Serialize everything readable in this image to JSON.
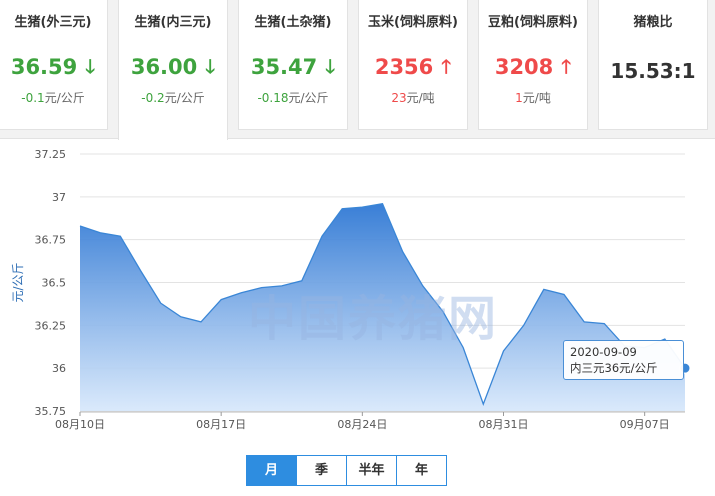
{
  "cards": [
    {
      "title": "生猪(外三元)",
      "price": "36.59",
      "dir": "down",
      "change": "-0.1",
      "unit": "元/公斤",
      "active": false
    },
    {
      "title": "生猪(内三元)",
      "price": "36.00",
      "dir": "down",
      "change": "-0.2",
      "unit": "元/公斤",
      "active": true
    },
    {
      "title": "生猪(土杂猪)",
      "price": "35.47",
      "dir": "down",
      "change": "-0.18",
      "unit": "元/公斤",
      "active": false
    },
    {
      "title": "玉米(饲料原料)",
      "price": "2356",
      "dir": "up",
      "change": "23",
      "unit": "元/吨",
      "active": false
    },
    {
      "title": "豆粕(饲料原料)",
      "price": "3208",
      "dir": "up",
      "change": "1",
      "unit": "元/吨",
      "active": false
    }
  ],
  "ratio": {
    "title": "猪粮比",
    "value": "15.53:1"
  },
  "arrows": {
    "down": "🡓",
    "up": "🡑"
  },
  "colors": {
    "down": "#3ea33e",
    "up": "#ef4a4a",
    "series": "#3a86d6",
    "accent": "#2e8de0"
  },
  "watermark": "中国养猪网",
  "tooltip": {
    "date": "2020-09-09",
    "value": "内三元36元/公斤"
  },
  "tabs": [
    {
      "label": "月",
      "active": true
    },
    {
      "label": "季",
      "active": false
    },
    {
      "label": "半年",
      "active": false
    },
    {
      "label": "年",
      "active": false
    }
  ],
  "chart_data": {
    "type": "area",
    "ylabel": "元/公斤",
    "ylim": [
      35.75,
      37.25
    ],
    "yticks": [
      "37.25",
      "37",
      "36.75",
      "36.5",
      "36.25",
      "36",
      "35.75"
    ],
    "xticklabels": [
      "08月10日",
      "08月17日",
      "08月24日",
      "08月31日",
      "09月07日"
    ],
    "grid": true,
    "series": [
      {
        "values": [
          {
            "x": "2020-08-10",
            "y": 36.83
          },
          {
            "x": "2020-08-11",
            "y": 36.79
          },
          {
            "x": "2020-08-12",
            "y": 36.77
          },
          {
            "x": "2020-08-13",
            "y": 36.57
          },
          {
            "x": "2020-08-14",
            "y": 36.38
          },
          {
            "x": "2020-08-15",
            "y": 36.3
          },
          {
            "x": "2020-08-16",
            "y": 36.27
          },
          {
            "x": "2020-08-17",
            "y": 36.4
          },
          {
            "x": "2020-08-18",
            "y": 36.44
          },
          {
            "x": "2020-08-19",
            "y": 36.47
          },
          {
            "x": "2020-08-20",
            "y": 36.48
          },
          {
            "x": "2020-08-21",
            "y": 36.51
          },
          {
            "x": "2020-08-22",
            "y": 36.77
          },
          {
            "x": "2020-08-23",
            "y": 36.93
          },
          {
            "x": "2020-08-24",
            "y": 36.94
          },
          {
            "x": "2020-08-25",
            "y": 36.96
          },
          {
            "x": "2020-08-26",
            "y": 36.68
          },
          {
            "x": "2020-08-27",
            "y": 36.48
          },
          {
            "x": "2020-08-28",
            "y": 36.33
          },
          {
            "x": "2020-08-29",
            "y": 36.12
          },
          {
            "x": "2020-08-30",
            "y": 35.79
          },
          {
            "x": "2020-08-31",
            "y": 36.1
          },
          {
            "x": "2020-09-01",
            "y": 36.25
          },
          {
            "x": "2020-09-02",
            "y": 36.46
          },
          {
            "x": "2020-09-03",
            "y": 36.43
          },
          {
            "x": "2020-09-04",
            "y": 36.27
          },
          {
            "x": "2020-09-05",
            "y": 36.26
          },
          {
            "x": "2020-09-06",
            "y": 36.13
          },
          {
            "x": "2020-09-07",
            "y": 36.12
          },
          {
            "x": "2020-09-08",
            "y": 36.17
          },
          {
            "x": "2020-09-09",
            "y": 36.0
          }
        ]
      }
    ]
  }
}
